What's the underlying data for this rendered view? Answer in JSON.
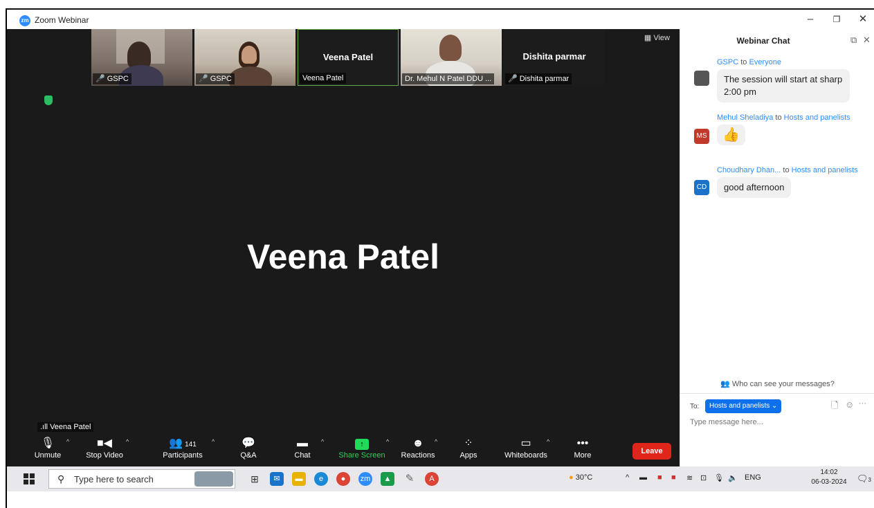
{
  "window": {
    "title": "Zoom Webinar",
    "logo": "zm"
  },
  "video": {
    "view_label": "View",
    "main_speaker": "Veena Patel",
    "active_speaker_indicator": "Veena Patel",
    "thumbnails": [
      {
        "label": "GSPC",
        "muted": true
      },
      {
        "label": "GSPC",
        "muted": true
      },
      {
        "label": "Veena Patel",
        "center_name": "Veena Patel",
        "muted": false
      },
      {
        "label": "Dr. Mehul N Patel DDU ...",
        "muted": false
      },
      {
        "label": "Dishita parmar",
        "center_name": "Dishita parmar",
        "muted": true
      }
    ]
  },
  "toolbar": {
    "unmute": "Unmute",
    "stop_video": "Stop Video",
    "participants": "Participants",
    "participants_count": "141",
    "qa": "Q&A",
    "chat": "Chat",
    "share_screen": "Share Screen",
    "reactions": "Reactions",
    "apps": "Apps",
    "whiteboards": "Whiteboards",
    "more": "More",
    "leave": "Leave"
  },
  "chat": {
    "title": "Webinar Chat",
    "messages": [
      {
        "sender": "GSPC",
        "to_word": "to",
        "recipient": "Everyone",
        "text_line1": "The session will start at sharp",
        "text_line2": "2:00 pm"
      },
      {
        "sender": "Mehul Sheladiya",
        "to_word": "to",
        "recipient": "Hosts and panelists",
        "avatar": "MS",
        "text": "👍"
      },
      {
        "sender": "Choudhary Dhan...",
        "to_word": "to",
        "recipient": "Hosts and panelists",
        "avatar": "CD",
        "text": "good afternoon"
      }
    ],
    "who_can_see": "Who can see your messages?",
    "to_label": "To:",
    "to_value": "Hosts and panelists ⌄",
    "input_placeholder": "Type message here..."
  },
  "taskbar": {
    "search_placeholder": "Type here to search",
    "weather": "30°C",
    "language": "ENG",
    "time": "14:02",
    "date": "06-03-2024",
    "notification_count": "3"
  },
  "colors": {
    "zoom_blue": "#2d8cff",
    "leave_red": "#e0261b",
    "share_green": "#23d959",
    "ms_avatar": "#c0392b",
    "cd_avatar": "#1a73c9"
  }
}
